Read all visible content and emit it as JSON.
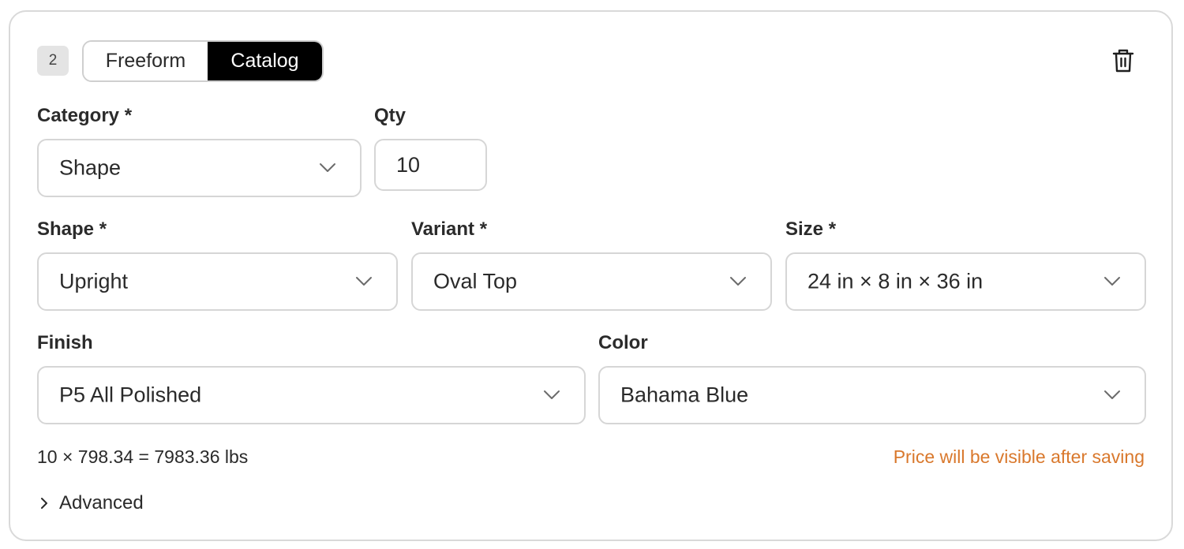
{
  "item": {
    "index": "2",
    "modes": [
      "Freeform",
      "Catalog"
    ],
    "selected_mode": "Catalog"
  },
  "fields": {
    "category": {
      "label": "Category *",
      "value": "Shape"
    },
    "qty": {
      "label": "Qty",
      "value": "10"
    },
    "shape": {
      "label": "Shape *",
      "value": "Upright"
    },
    "variant": {
      "label": "Variant *",
      "value": "Oval Top"
    },
    "size": {
      "label": "Size *",
      "value": "24 in × 8 in × 36 in"
    },
    "finish": {
      "label": "Finish",
      "value": "P5 All Polished"
    },
    "color": {
      "label": "Color",
      "value": "Bahama Blue"
    }
  },
  "summary": {
    "weight_calc": "10 × 798.34 = 7983.36 lbs",
    "price_note": "Price will be visible after saving",
    "price_note_color": "#d9782c"
  },
  "advanced": {
    "label": "Advanced"
  },
  "icons": {
    "delete": "trash-icon",
    "dropdown": "chevron-down-icon",
    "expand": "chevron-right-icon"
  }
}
